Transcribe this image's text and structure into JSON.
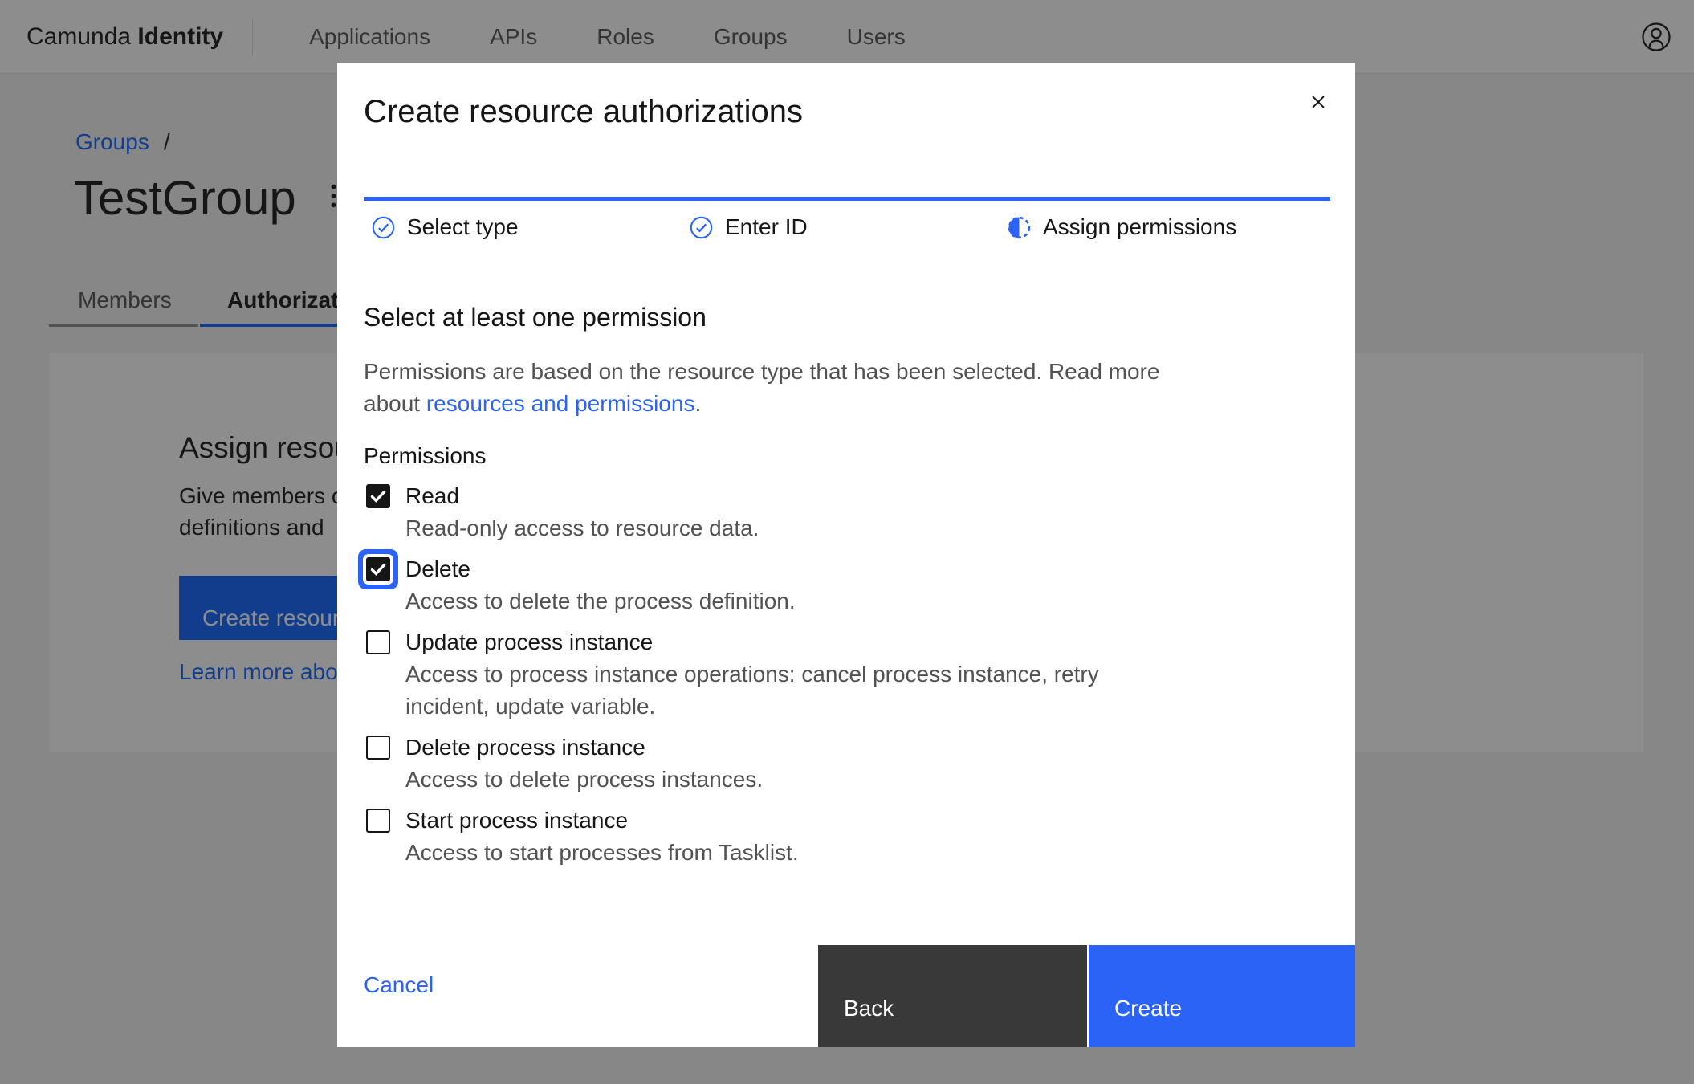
{
  "colors": {
    "accent_blue": "#2a63f5",
    "page_link_blue": "#0f62fe",
    "text_primary": "#161616",
    "text_secondary": "#525252",
    "button_secondary": "#393939",
    "page_background": "#f4f4f4",
    "overlay": "rgba(22,22,22,0.49)"
  },
  "header": {
    "brand_prefix": "Camunda",
    "brand_suffix": "Identity",
    "nav_items": [
      "Applications",
      "APIs",
      "Roles",
      "Groups",
      "Users"
    ]
  },
  "page": {
    "breadcrumb_link": "Groups",
    "breadcrumb_separator": "/",
    "title": "TestGroup",
    "tab_members": "Members",
    "tab_authorizations": "Authorizat",
    "card": {
      "heading": "Assign resou",
      "body_line1": "Give members o",
      "body_line2": "definitions and",
      "button_label": "Create resour",
      "link_label": "Learn more abo"
    }
  },
  "modal": {
    "title": "Create resource authorizations",
    "steps": [
      {
        "label": "Select type",
        "state": "complete"
      },
      {
        "label": "Enter ID",
        "state": "complete"
      },
      {
        "label": "Assign permissions",
        "state": "current"
      }
    ],
    "section_heading": "Select at least one permission",
    "description": {
      "line1": "Permissions are based on the resource type that has been selected. Read more",
      "line2_prefix": "about ",
      "link_text": "resources and permissions",
      "line2_suffix": "."
    },
    "permissions_label": "Permissions",
    "permissions": [
      {
        "label": "Read",
        "checked": true,
        "focused": false,
        "description_lines": [
          "Read-only access to resource data."
        ]
      },
      {
        "label": "Delete",
        "checked": true,
        "focused": true,
        "description_lines": [
          "Access to delete the process definition."
        ]
      },
      {
        "label": "Update process instance",
        "checked": false,
        "focused": false,
        "description_lines": [
          "Access to process instance operations: cancel process instance, retry",
          "incident, update variable."
        ]
      },
      {
        "label": "Delete process instance",
        "checked": false,
        "focused": false,
        "description_lines": [
          "Access to delete process instances."
        ]
      },
      {
        "label": "Start process instance",
        "checked": false,
        "focused": false,
        "description_lines": [
          "Access to start processes from Tasklist."
        ]
      }
    ],
    "footer": {
      "cancel_label": "Cancel",
      "back_label": "Back",
      "create_label": "Create"
    }
  }
}
